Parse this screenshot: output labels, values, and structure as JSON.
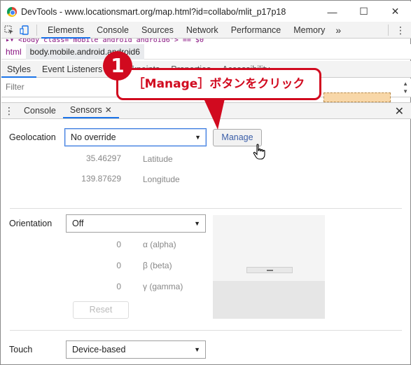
{
  "window": {
    "title": "DevTools - www.locationsmart.org/map.html?id=collabo/mlit_p17p18",
    "minimize": "—",
    "maximize": "☐",
    "close": "✕"
  },
  "toolbar": {
    "tabs": [
      "Elements",
      "Console",
      "Sources",
      "Network",
      "Performance",
      "Memory"
    ],
    "more": "»",
    "kebab": "⋮"
  },
  "source_line": "▸▾ <body class=\"mobile android android6\"> == $0",
  "breadcrumbs": [
    "html",
    "body.mobile.android.android6"
  ],
  "subtabs": [
    "Styles",
    "Event Listeners",
    "Breakpoints",
    "Properties",
    "Accessibility"
  ],
  "filter": {
    "placeholder": "Filter"
  },
  "drawer": {
    "kebab": "⋮",
    "tabs": [
      {
        "label": "Console"
      },
      {
        "label": "Sensors",
        "close": "✕"
      }
    ],
    "close": "✕"
  },
  "sensors": {
    "geolocation": {
      "label": "Geolocation",
      "selected": "No override",
      "manage_label": "Manage",
      "latitude_value": "35.46297",
      "latitude_label": "Latitude",
      "longitude_value": "139.87629",
      "longitude_label": "Longitude"
    },
    "orientation": {
      "label": "Orientation",
      "selected": "Off",
      "alpha_value": "0",
      "alpha_label": "α (alpha)",
      "beta_value": "0",
      "beta_label": "β (beta)",
      "gamma_value": "0",
      "gamma_label": "γ (gamma)",
      "reset_label": "Reset"
    },
    "touch": {
      "label": "Touch",
      "selected": "Device-based"
    }
  },
  "annotation": {
    "number": "1",
    "text": "［Manage］ボタンをクリック",
    "color": "#d10a1f"
  }
}
